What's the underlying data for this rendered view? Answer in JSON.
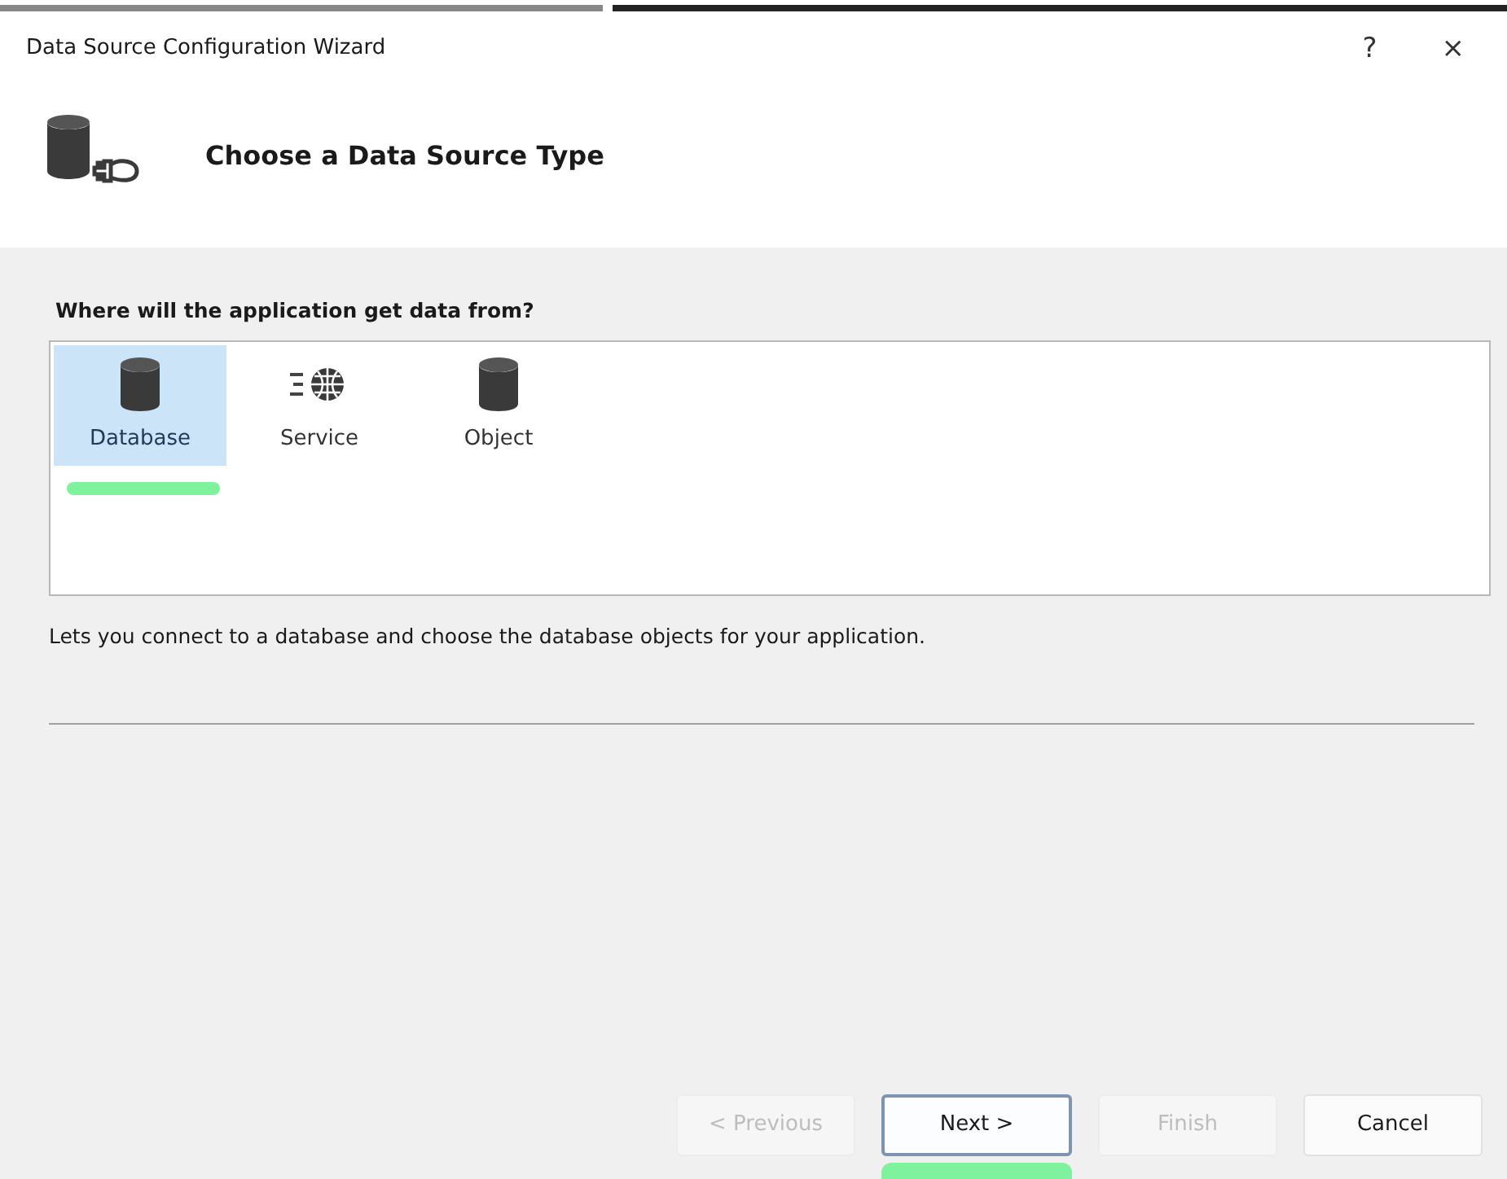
{
  "window": {
    "title": "Data Source Configuration Wizard",
    "help": "?",
    "close": "×"
  },
  "header": {
    "title": "Choose a Data Source Type"
  },
  "question": "Where will the application get data from?",
  "sources": [
    {
      "kind": "database",
      "label": "Database",
      "selected": true,
      "highlighted": true
    },
    {
      "kind": "service",
      "label": "Service",
      "selected": false,
      "highlighted": false
    },
    {
      "kind": "object",
      "label": "Object",
      "selected": false,
      "highlighted": false
    }
  ],
  "description": "Lets you connect to a database and choose the database objects for your application.",
  "buttons": [
    {
      "label": "< Previous",
      "disabled": true,
      "default": false,
      "highlighted": false
    },
    {
      "label": "Next >",
      "disabled": false,
      "default": true,
      "highlighted": true
    },
    {
      "label": "Finish",
      "disabled": true,
      "default": false,
      "highlighted": false
    },
    {
      "label": "Cancel",
      "disabled": false,
      "default": false,
      "highlighted": false
    }
  ]
}
